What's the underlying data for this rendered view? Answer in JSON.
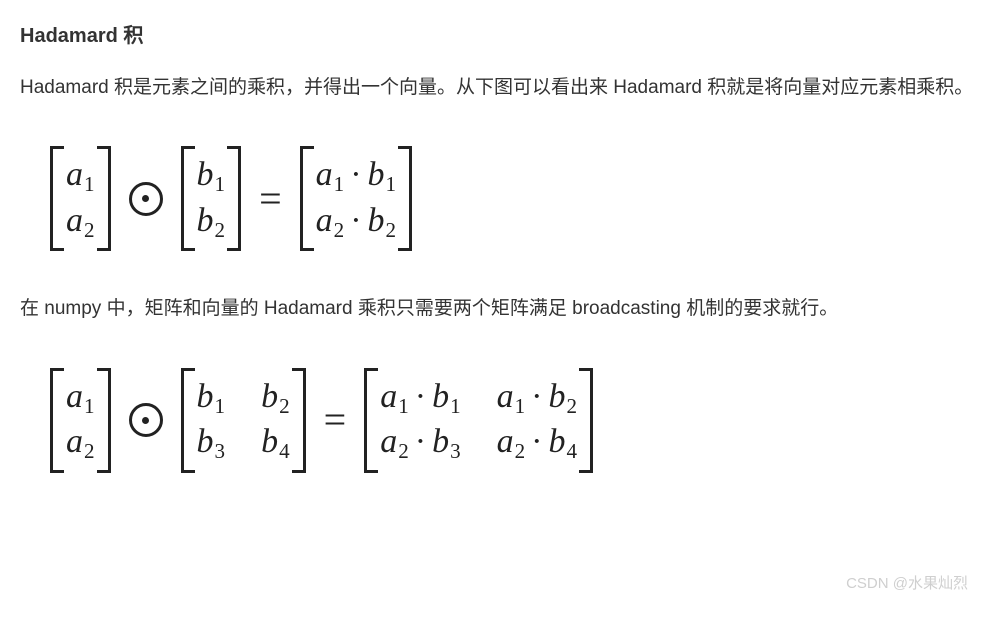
{
  "heading": "Hadamard 积",
  "para1": "Hadamard 积是元素之间的乘积，并得出一个向量。从下图可以看出来 Hadamard 积就是将向量对应元素相乘积。",
  "para2": "在 numpy 中，矩阵和向量的 Hadamard 乘积只需要两个矩阵满足 broadcasting 机制的要求就行。",
  "formula1": {
    "left": {
      "cols": 1,
      "cells": [
        "a_1",
        "a_2"
      ]
    },
    "op1": "⊙",
    "middle": {
      "cols": 1,
      "cells": [
        "b_1",
        "b_2"
      ]
    },
    "op2": "=",
    "right": {
      "cols": 1,
      "cells": [
        "a_1 · b_1",
        "a_2 · b_2"
      ]
    }
  },
  "formula2": {
    "left": {
      "cols": 1,
      "cells": [
        "a_1",
        "a_2"
      ]
    },
    "op1": "⊙",
    "middle": {
      "cols": 2,
      "cells": [
        "b_1",
        "b_2",
        "b_3",
        "b_4"
      ]
    },
    "op2": "=",
    "right": {
      "cols": 2,
      "cells": [
        "a_1 · b_1",
        "a_1 · b_2",
        "a_2 · b_3",
        "a_2 · b_4"
      ]
    }
  },
  "watermark": "CSDN @水果灿烈"
}
